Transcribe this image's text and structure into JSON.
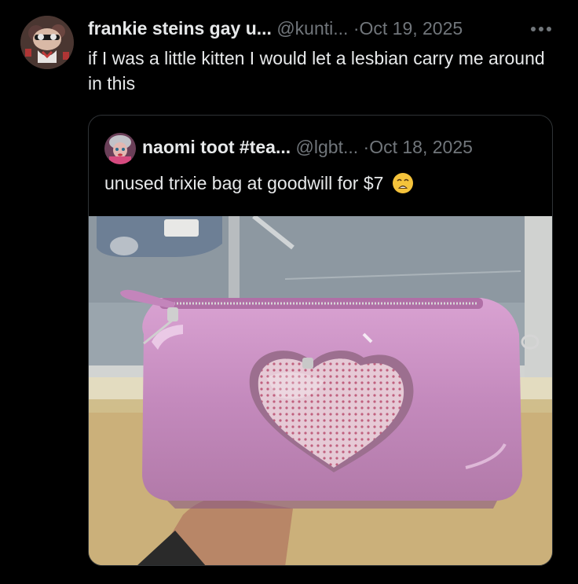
{
  "tweet": {
    "display_name": "frankie steins gay u...",
    "handle": "@kunti...",
    "separator": "·",
    "date": "Oct 19, 2025",
    "text": "if I was a little kitten I would let a lesbian carry me around in this",
    "icons": {
      "avatar": "avatar",
      "more": "more-horizontal-icon"
    }
  },
  "quoted_tweet": {
    "display_name": "naomi toot #tea...",
    "handle": "@lgbt...",
    "separator": "·",
    "date": "Oct 18, 2025",
    "text": "unused trixie bag at goodwill for $7",
    "emoji": "weary-face-emoji-icon",
    "media": "photo of pink patent-leather bag with heart window"
  },
  "colors": {
    "background": "#000000",
    "primary_text": "#e7e9ea",
    "secondary_text": "#71767b",
    "border": "#2f3336",
    "bag_pink": "#c98bc3"
  }
}
